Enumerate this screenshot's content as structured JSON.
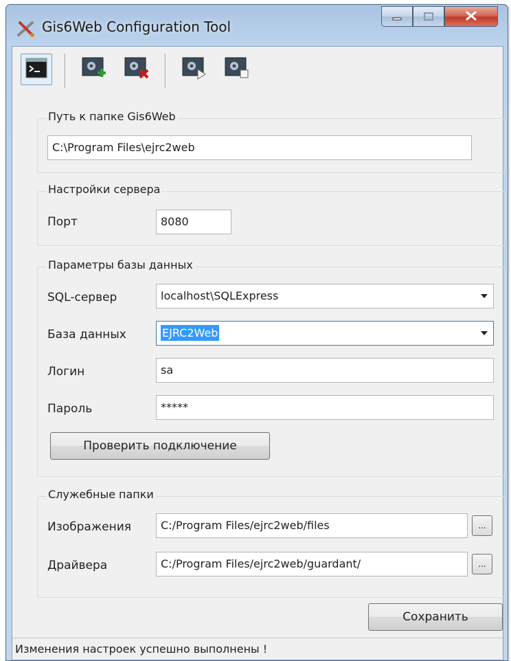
{
  "window": {
    "title": "Gis6Web Configuration Tool",
    "app_icon": "scissors-tool-icon"
  },
  "titlebar_controls": [
    "minimize-icon",
    "maximize-icon",
    "close-icon"
  ],
  "toolbar": {
    "buttons": [
      {
        "icon": "console-icon",
        "pressed": true
      },
      {
        "icon": "service-add-icon"
      },
      {
        "icon": "service-remove-icon"
      },
      {
        "icon": "service-start-icon"
      },
      {
        "icon": "service-stop-icon"
      }
    ]
  },
  "path_group": {
    "legend": "Путь к папке Gis6Web",
    "value": "C:\\Program Files\\ejrc2web"
  },
  "server_group": {
    "legend": "Настройки сервера",
    "port_label": "Порт",
    "port_value": "8080"
  },
  "db_group": {
    "legend": "Параметры базы данных",
    "sql_label": "SQL-сервер",
    "sql_value": "localhost\\SQLExpress",
    "db_label": "База данных",
    "db_value": "EJRC2Web",
    "login_label": "Логин",
    "login_value": "sa",
    "password_label": "Пароль",
    "password_value": "*****",
    "test_button": "Проверить подключение"
  },
  "folders_group": {
    "legend": "Служебные папки",
    "images_label": "Изображения",
    "images_value": "C:/Program Files/ejrc2web/files",
    "drivers_label": "Драйвера",
    "drivers_value": "C:/Program Files/ejrc2web/guardant/",
    "browse_label": "..."
  },
  "save_button": "Сохранить",
  "status": "Изменения настроек успешно выполнены !",
  "colors": {
    "selection": "#3399ff",
    "close_button": "#c0392b",
    "title_bar": "#bcd3ec"
  }
}
